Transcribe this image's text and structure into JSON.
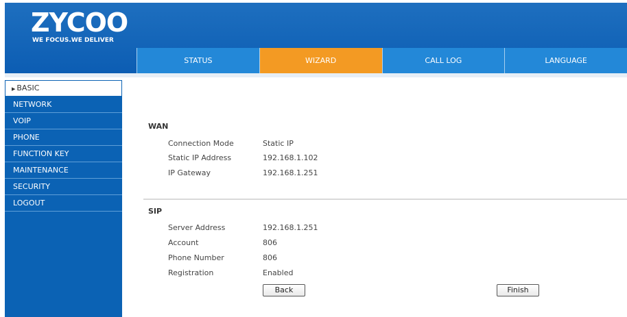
{
  "header": {
    "logo_text": "ZYCOO",
    "tagline": "WE FOCUS.WE DELIVER",
    "tabs": [
      {
        "label": "STATUS"
      },
      {
        "label": "WIZARD"
      },
      {
        "label": "CALL LOG"
      },
      {
        "label": "LANGUAGE"
      }
    ],
    "active_tab": "WIZARD"
  },
  "sidebar": {
    "items": [
      {
        "label": "BASIC",
        "active": true
      },
      {
        "label": "NETWORK"
      },
      {
        "label": "VOIP"
      },
      {
        "label": "PHONE"
      },
      {
        "label": "FUNCTION KEY"
      },
      {
        "label": "MAINTENANCE"
      },
      {
        "label": "SECURITY"
      },
      {
        "label": "LOGOUT"
      }
    ]
  },
  "wan": {
    "title": "WAN",
    "rows": [
      {
        "label": "Connection Mode",
        "value": "Static IP"
      },
      {
        "label": "Static IP Address",
        "value": "192.168.1.102"
      },
      {
        "label": "IP Gateway",
        "value": "192.168.1.251"
      }
    ]
  },
  "sip": {
    "title": "SIP",
    "rows": [
      {
        "label": "Server Address",
        "value": "192.168.1.251"
      },
      {
        "label": "Account",
        "value": "806"
      },
      {
        "label": "Phone Number",
        "value": "806"
      },
      {
        "label": "Registration",
        "value": "Enabled"
      }
    ]
  },
  "buttons": {
    "back": "Back",
    "finish": "Finish"
  },
  "colors": {
    "header_blue": "#0c5db3",
    "tab_blue": "#2388d8",
    "tab_active_orange": "#f39a23",
    "sidebar_blue": "#0b62b4"
  }
}
